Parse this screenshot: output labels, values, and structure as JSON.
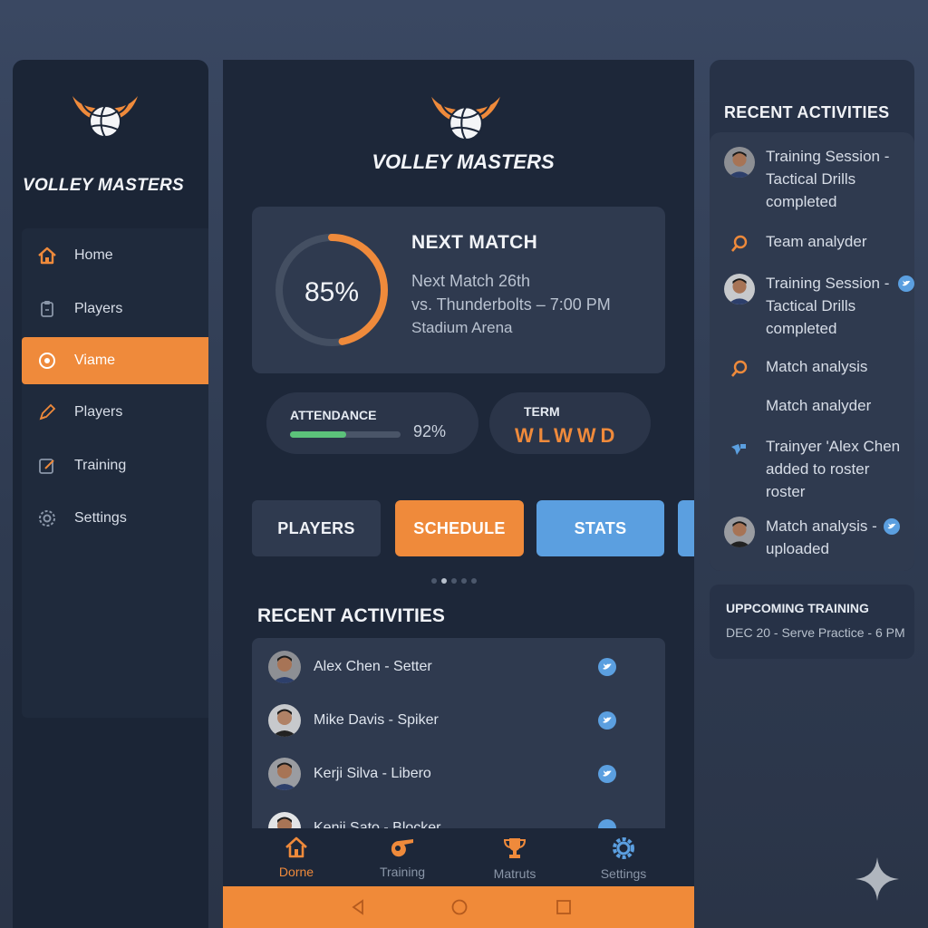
{
  "brand": {
    "name": "VOLLEY MASTERS"
  },
  "colors": {
    "accent": "#ef8a3b",
    "blue": "#5b9fe0",
    "green": "#5cc27a",
    "bg": "#1d2739"
  },
  "sidebar": {
    "items": [
      {
        "label": "Home",
        "icon": "home-icon",
        "active": false
      },
      {
        "label": "Players",
        "icon": "clipboard-icon",
        "active": false
      },
      {
        "label": "Viame",
        "icon": "target-icon",
        "active": true
      },
      {
        "label": "Players",
        "icon": "pencil-icon",
        "active": false
      },
      {
        "label": "Training",
        "icon": "edit-icon",
        "active": false
      },
      {
        "label": "Settings",
        "icon": "gear-icon",
        "active": false
      }
    ]
  },
  "next_match": {
    "title": "NEXT MATCH",
    "percent": 85,
    "percent_label": "85%",
    "line1": "Next Match 26th",
    "line2": "vs. Thunderbolts – 7:00 PM",
    "line3": "Stadium Arena"
  },
  "attendance": {
    "label": "ATTENDANCE",
    "value": 92,
    "value_label": "92%"
  },
  "term": {
    "label": "TERM",
    "value": "WLWWD"
  },
  "tabs": [
    {
      "label": "PLAYERS",
      "color": "#2f3a4f"
    },
    {
      "label": "SCHEDULE",
      "color": "#ef8a3b"
    },
    {
      "label": "STATS",
      "color": "#5b9fe0"
    }
  ],
  "recent": {
    "title": "RECENT ACTIVITIES",
    "players": [
      {
        "name": "Alex Chen - Setter"
      },
      {
        "name": "Mike Davis - Spiker"
      },
      {
        "name": "Kerji Silva - Libero"
      },
      {
        "name": "Kenji Sato - Blocker"
      }
    ]
  },
  "bottom_nav": [
    {
      "label": "Dorne",
      "icon": "home-icon",
      "active": true
    },
    {
      "label": "Training",
      "icon": "whistle-icon",
      "active": false
    },
    {
      "label": "Matruts",
      "icon": "trophy-icon",
      "active": false
    },
    {
      "label": "Settings",
      "icon": "gear-icon",
      "active": false
    }
  ],
  "right_panel": {
    "title": "RECENT ACTIVITIES",
    "items": [
      {
        "text": "Training Session - Tactical Drills completed",
        "kind": "avatar"
      },
      {
        "text": "Team analyder",
        "kind": "search"
      },
      {
        "text": "Training Session - Tactical Drills completed",
        "kind": "avatar-twitter"
      },
      {
        "text": "Match analysis",
        "kind": "search"
      },
      {
        "text": "Match analyder",
        "kind": "none"
      },
      {
        "text": "Trainyer 'Alex Chen added to roster roster",
        "kind": "whistle"
      },
      {
        "text": "Match analysis - uploaded",
        "kind": "avatar-twitter"
      }
    ]
  },
  "upcoming": {
    "title": "UPPCOMING TRAINING",
    "text": "DEC 20 - Serve Practice - 6 PM"
  }
}
